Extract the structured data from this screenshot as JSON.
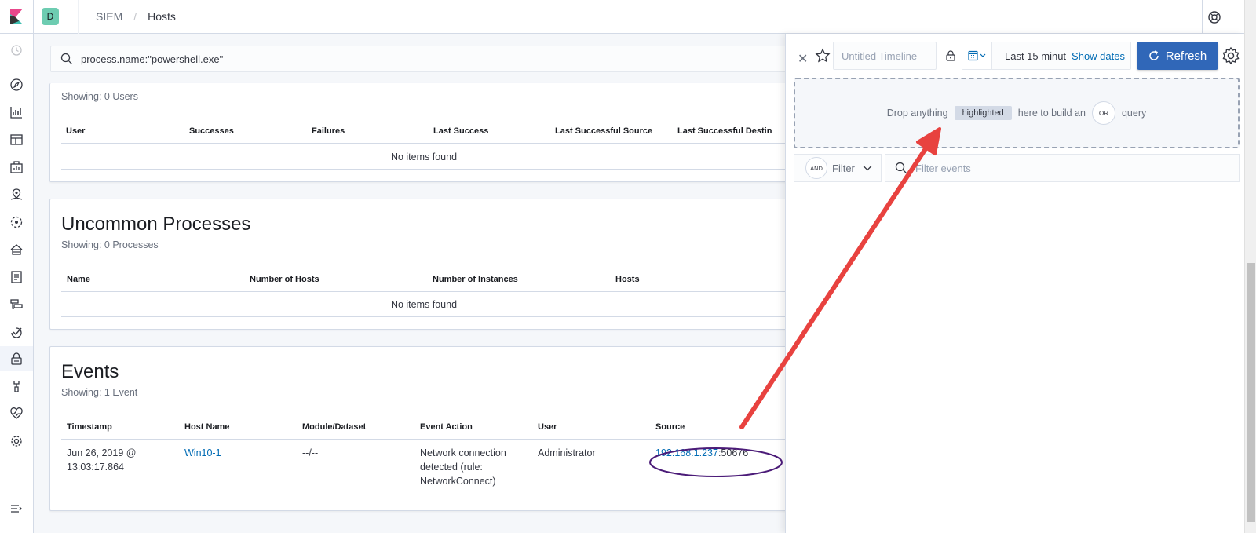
{
  "header": {
    "space_initial": "D",
    "breadcrumb": [
      "SIEM",
      "Hosts"
    ],
    "breadcrumb_sep": "/"
  },
  "search": {
    "query": "process.name:\"powershell.exe\""
  },
  "users_panel": {
    "showing": "Showing: 0 Users",
    "columns": [
      "User",
      "Successes",
      "Failures",
      "Last Success",
      "Last Successful Source",
      "Last Successful Destin"
    ],
    "empty": "No items found"
  },
  "processes_panel": {
    "title": "Uncommon Processes",
    "showing": "Showing: 0 Processes",
    "columns": [
      "Name",
      "Number of Hosts",
      "Number of Instances",
      "Hosts"
    ],
    "empty": "No items found"
  },
  "events_panel": {
    "title": "Events",
    "showing": "Showing: 1 Event",
    "columns": [
      "Timestamp",
      "Host Name",
      "Module/Dataset",
      "Event Action",
      "User",
      "Source"
    ],
    "row": {
      "timestamp_1": "Jun 26, 2019 @",
      "timestamp_2": "13:03:17.864",
      "host": "Win10-1",
      "module": "--/--",
      "action_1": "Network connection",
      "action_2": "detected (rule:",
      "action_3": "NetworkConnect)",
      "user": "Administrator",
      "source_ip": "192.168.1.237",
      "source_port": ":50676"
    }
  },
  "timeline": {
    "title_placeholder": "Untitled Timeline",
    "date_range": "Last 15 minut",
    "show_dates": "Show dates",
    "refresh": "Refresh",
    "drop_1": "Drop anything",
    "drop_highlight": "highlighted",
    "drop_2": "here to build an",
    "drop_or": "OR",
    "drop_3": "query",
    "filter_and": "AND",
    "filter_label": "Filter",
    "events_placeholder": "Filter events"
  },
  "colors": {
    "accent": "#3067b8",
    "link": "#006bb4",
    "annotation_arrow": "#e8423f",
    "annotation_circle": "#4b1b78"
  }
}
